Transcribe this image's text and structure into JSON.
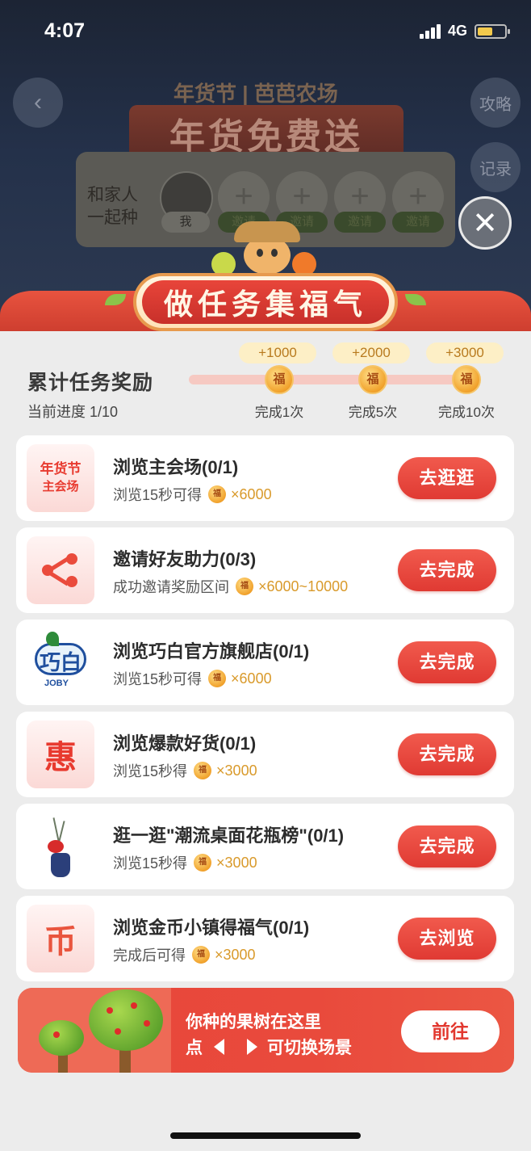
{
  "status_bar": {
    "time": "4:07",
    "network": "4G"
  },
  "background_page": {
    "brand": "年货节 | 芭芭农场",
    "banner": "年货免费送",
    "strategy": "攻略",
    "records": "记录",
    "family_label": "和家人一起种",
    "me_label": "我",
    "invite_labels": [
      "邀请",
      "邀请",
      "邀请",
      "邀请"
    ]
  },
  "modal": {
    "title": "做任务集福气",
    "progress": {
      "title": "累计任务奖励",
      "current": "当前进度 1/10",
      "milestones": [
        {
          "reward": "+1000",
          "coin": "福",
          "label": "完成1次"
        },
        {
          "reward": "+2000",
          "coin": "福",
          "label": "完成5次"
        },
        {
          "reward": "+3000",
          "coin": "福",
          "label": "完成10次"
        }
      ]
    },
    "tasks": [
      {
        "icon_text1": "年货节",
        "icon_text2": "主会场",
        "title": "浏览主会场(0/1)",
        "reward_text": "浏览15秒可得",
        "amount": "×6000",
        "button": "去逛逛"
      },
      {
        "title": "邀请好友助力(0/3)",
        "reward_text": "成功邀请奖励区间",
        "amount": "×6000~10000",
        "button": "去完成"
      },
      {
        "icon_text1": "巧白",
        "icon_text2": "JOBY",
        "title": "浏览巧白官方旗舰店(0/1)",
        "reward_text": "浏览15秒可得",
        "amount": "×6000",
        "button": "去完成"
      },
      {
        "icon_text1": "惠",
        "title": "浏览爆款好货(0/1)",
        "reward_text": "浏览15秒得",
        "amount": "×3000",
        "button": "去完成"
      },
      {
        "title": "逛一逛\"潮流桌面花瓶榜\"(0/1)",
        "reward_text": "浏览15秒得",
        "amount": "×3000",
        "button": "去完成"
      },
      {
        "icon_text1": "币",
        "title": "浏览金币小镇得福气(0/1)",
        "reward_text": "完成后可得",
        "amount": "×3000",
        "button": "去浏览"
      }
    ],
    "coin_glyph": "福",
    "tree_banner": {
      "line1": "你种的果树在这里",
      "line2_prefix": "点",
      "line2_suffix": "可切换场景",
      "button": "前往"
    }
  }
}
